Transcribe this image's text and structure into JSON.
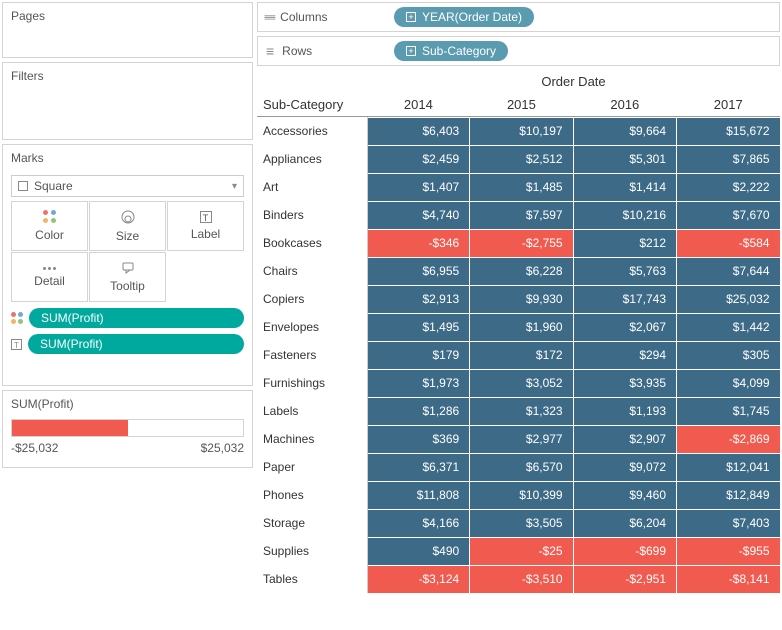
{
  "panels": {
    "pages": "Pages",
    "filters": "Filters",
    "marks": "Marks",
    "markType": "Square",
    "buttons": {
      "color": "Color",
      "size": "Size",
      "label": "Label",
      "detail": "Detail",
      "tooltip": "Tooltip"
    },
    "pill1": "SUM(Profit)",
    "pill2": "SUM(Profit)",
    "legendTitle": "SUM(Profit)",
    "legendMin": "-$25,032",
    "legendMax": "$25,032"
  },
  "shelves": {
    "columnsLabel": "Columns",
    "rowsLabel": "Rows",
    "columnsPill": "YEAR(Order Date)",
    "rowsPill": "Sub-Category"
  },
  "viz": {
    "colHeader": "Order Date",
    "rowHeader": "Sub-Category",
    "years": [
      "2014",
      "2015",
      "2016",
      "2017"
    ],
    "rows": [
      {
        "label": "Accessories",
        "cells": [
          {
            "v": "$6,403",
            "c": "pos"
          },
          {
            "v": "$10,197",
            "c": "pos"
          },
          {
            "v": "$9,664",
            "c": "pos"
          },
          {
            "v": "$15,672",
            "c": "pos"
          }
        ]
      },
      {
        "label": "Appliances",
        "cells": [
          {
            "v": "$2,459",
            "c": "pos"
          },
          {
            "v": "$2,512",
            "c": "pos"
          },
          {
            "v": "$5,301",
            "c": "pos"
          },
          {
            "v": "$7,865",
            "c": "pos"
          }
        ]
      },
      {
        "label": "Art",
        "cells": [
          {
            "v": "$1,407",
            "c": "pos"
          },
          {
            "v": "$1,485",
            "c": "pos"
          },
          {
            "v": "$1,414",
            "c": "pos"
          },
          {
            "v": "$2,222",
            "c": "pos"
          }
        ]
      },
      {
        "label": "Binders",
        "cells": [
          {
            "v": "$4,740",
            "c": "pos"
          },
          {
            "v": "$7,597",
            "c": "pos"
          },
          {
            "v": "$10,216",
            "c": "pos"
          },
          {
            "v": "$7,670",
            "c": "pos"
          }
        ]
      },
      {
        "label": "Bookcases",
        "cells": [
          {
            "v": "-$346",
            "c": "neg"
          },
          {
            "v": "-$2,755",
            "c": "neg"
          },
          {
            "v": "$212",
            "c": "pos"
          },
          {
            "v": "-$584",
            "c": "neg"
          }
        ]
      },
      {
        "label": "Chairs",
        "cells": [
          {
            "v": "$6,955",
            "c": "pos"
          },
          {
            "v": "$6,228",
            "c": "pos"
          },
          {
            "v": "$5,763",
            "c": "pos"
          },
          {
            "v": "$7,644",
            "c": "pos"
          }
        ]
      },
      {
        "label": "Copiers",
        "cells": [
          {
            "v": "$2,913",
            "c": "pos"
          },
          {
            "v": "$9,930",
            "c": "pos"
          },
          {
            "v": "$17,743",
            "c": "pos"
          },
          {
            "v": "$25,032",
            "c": "pos"
          }
        ]
      },
      {
        "label": "Envelopes",
        "cells": [
          {
            "v": "$1,495",
            "c": "pos"
          },
          {
            "v": "$1,960",
            "c": "pos"
          },
          {
            "v": "$2,067",
            "c": "pos"
          },
          {
            "v": "$1,442",
            "c": "pos"
          }
        ]
      },
      {
        "label": "Fasteners",
        "cells": [
          {
            "v": "$179",
            "c": "pos"
          },
          {
            "v": "$172",
            "c": "pos"
          },
          {
            "v": "$294",
            "c": "pos"
          },
          {
            "v": "$305",
            "c": "pos"
          }
        ]
      },
      {
        "label": "Furnishings",
        "cells": [
          {
            "v": "$1,973",
            "c": "pos"
          },
          {
            "v": "$3,052",
            "c": "pos"
          },
          {
            "v": "$3,935",
            "c": "pos"
          },
          {
            "v": "$4,099",
            "c": "pos"
          }
        ]
      },
      {
        "label": "Labels",
        "cells": [
          {
            "v": "$1,286",
            "c": "pos"
          },
          {
            "v": "$1,323",
            "c": "pos"
          },
          {
            "v": "$1,193",
            "c": "pos"
          },
          {
            "v": "$1,745",
            "c": "pos"
          }
        ]
      },
      {
        "label": "Machines",
        "cells": [
          {
            "v": "$369",
            "c": "pos"
          },
          {
            "v": "$2,977",
            "c": "pos"
          },
          {
            "v": "$2,907",
            "c": "pos"
          },
          {
            "v": "-$2,869",
            "c": "neg"
          }
        ]
      },
      {
        "label": "Paper",
        "cells": [
          {
            "v": "$6,371",
            "c": "pos"
          },
          {
            "v": "$6,570",
            "c": "pos"
          },
          {
            "v": "$9,072",
            "c": "pos"
          },
          {
            "v": "$12,041",
            "c": "pos"
          }
        ]
      },
      {
        "label": "Phones",
        "cells": [
          {
            "v": "$11,808",
            "c": "pos"
          },
          {
            "v": "$10,399",
            "c": "pos"
          },
          {
            "v": "$9,460",
            "c": "pos"
          },
          {
            "v": "$12,849",
            "c": "pos"
          }
        ]
      },
      {
        "label": "Storage",
        "cells": [
          {
            "v": "$4,166",
            "c": "pos"
          },
          {
            "v": "$3,505",
            "c": "pos"
          },
          {
            "v": "$6,204",
            "c": "pos"
          },
          {
            "v": "$7,403",
            "c": "pos"
          }
        ]
      },
      {
        "label": "Supplies",
        "cells": [
          {
            "v": "$490",
            "c": "pos"
          },
          {
            "v": "-$25",
            "c": "neg"
          },
          {
            "v": "-$699",
            "c": "neg"
          },
          {
            "v": "-$955",
            "c": "neg"
          }
        ]
      },
      {
        "label": "Tables",
        "cells": [
          {
            "v": "-$3,124",
            "c": "neg"
          },
          {
            "v": "-$3,510",
            "c": "neg"
          },
          {
            "v": "-$2,951",
            "c": "neg"
          },
          {
            "v": "-$8,141",
            "c": "neg"
          }
        ]
      }
    ]
  },
  "chart_data": {
    "type": "heatmap",
    "title": "",
    "xlabel": "Order Date",
    "ylabel": "Sub-Category",
    "x": [
      "2014",
      "2015",
      "2016",
      "2017"
    ],
    "y": [
      "Accessories",
      "Appliances",
      "Art",
      "Binders",
      "Bookcases",
      "Chairs",
      "Copiers",
      "Envelopes",
      "Fasteners",
      "Furnishings",
      "Labels",
      "Machines",
      "Paper",
      "Phones",
      "Storage",
      "Supplies",
      "Tables"
    ],
    "values": [
      [
        6403,
        10197,
        9664,
        15672
      ],
      [
        2459,
        2512,
        5301,
        7865
      ],
      [
        1407,
        1485,
        1414,
        2222
      ],
      [
        4740,
        7597,
        10216,
        7670
      ],
      [
        -346,
        -2755,
        212,
        -584
      ],
      [
        6955,
        6228,
        5763,
        7644
      ],
      [
        2913,
        9930,
        17743,
        25032
      ],
      [
        1495,
        1960,
        2067,
        1442
      ],
      [
        179,
        172,
        294,
        305
      ],
      [
        1973,
        3052,
        3935,
        4099
      ],
      [
        1286,
        1323,
        1193,
        1745
      ],
      [
        369,
        2977,
        2907,
        -2869
      ],
      [
        6371,
        6570,
        9072,
        12041
      ],
      [
        11808,
        10399,
        9460,
        12849
      ],
      [
        4166,
        3505,
        6204,
        7403
      ],
      [
        490,
        -25,
        -699,
        -955
      ],
      [
        -3124,
        -3510,
        -2951,
        -8141
      ]
    ],
    "color_scale": {
      "min": -25032,
      "max": 25032,
      "neg_color": "#f15a4e",
      "pos_color": "#3d6a86"
    }
  }
}
